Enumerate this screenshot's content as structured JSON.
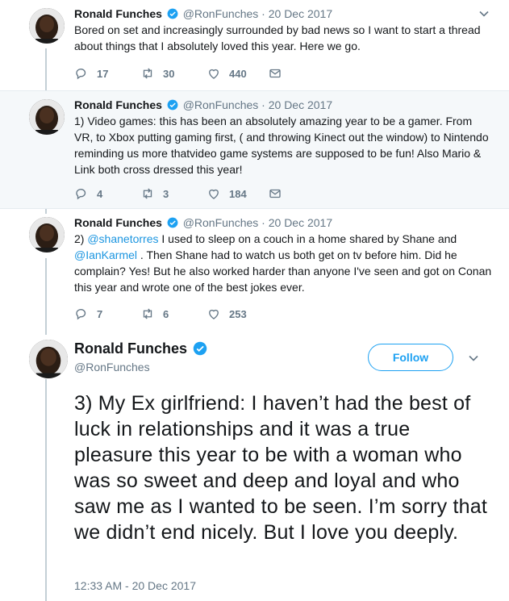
{
  "thread": [
    {
      "name": "Ronald Funches",
      "handle": "@RonFunches",
      "date": "20 Dec 2017",
      "text": "Bored on set and increasingly surrounded by bad news so I want to start a thread about things that I absolutely loved this year.  Here we go.",
      "replies": "17",
      "retweets": "30",
      "likes": "440"
    },
    {
      "name": "Ronald Funches",
      "handle": "@RonFunches",
      "date": "20 Dec 2017",
      "text": "1) Video games:  this has been an absolutely amazing year to be a gamer. From VR, to Xbox putting gaming first, ( and throwing Kinect out the window)  to Nintendo reminding us more thatvideo game systems are supposed to be fun! Also Mario & Link both cross dressed this year!",
      "replies": "4",
      "retweets": "3",
      "likes": "184"
    },
    {
      "name": "Ronald Funches",
      "handle": "@RonFunches",
      "date": "20 Dec 2017",
      "text_prefix": "2) ",
      "mention1": "@shanetorres",
      "text_mid": "  I used to sleep on a couch in a home shared by Shane and ",
      "mention2": "@IanKarmel",
      "text_suffix": " . Then Shane had to watch us both get on tv before him. Did he complain? Yes!  But he also worked harder than anyone I've seen and got on Conan this year and wrote one of the best jokes ever.",
      "replies": "7",
      "retweets": "6",
      "likes": "253"
    }
  ],
  "main": {
    "name": "Ronald Funches",
    "handle": "@RonFunches",
    "follow_label": "Follow",
    "text": "3)  My Ex girlfriend: I haven’t had the best of luck in relationships and it was a true pleasure this year to be with a woman who was so sweet and deep and loyal and who saw me as I wanted to be seen. I’m sorry that we didn’t end nicely. But I love you deeply.",
    "timestamp": "12:33 AM - 20 Dec 2017"
  },
  "colors": {
    "accent": "#1da1f2",
    "link": "#1b95e0",
    "muted": "#657786",
    "thread_line": "#c4cfd6",
    "highlight_bg": "#f5f8fa"
  },
  "icons": [
    "verified-icon",
    "chevron-down-icon",
    "reply-icon",
    "retweet-icon",
    "like-icon",
    "message-icon"
  ]
}
